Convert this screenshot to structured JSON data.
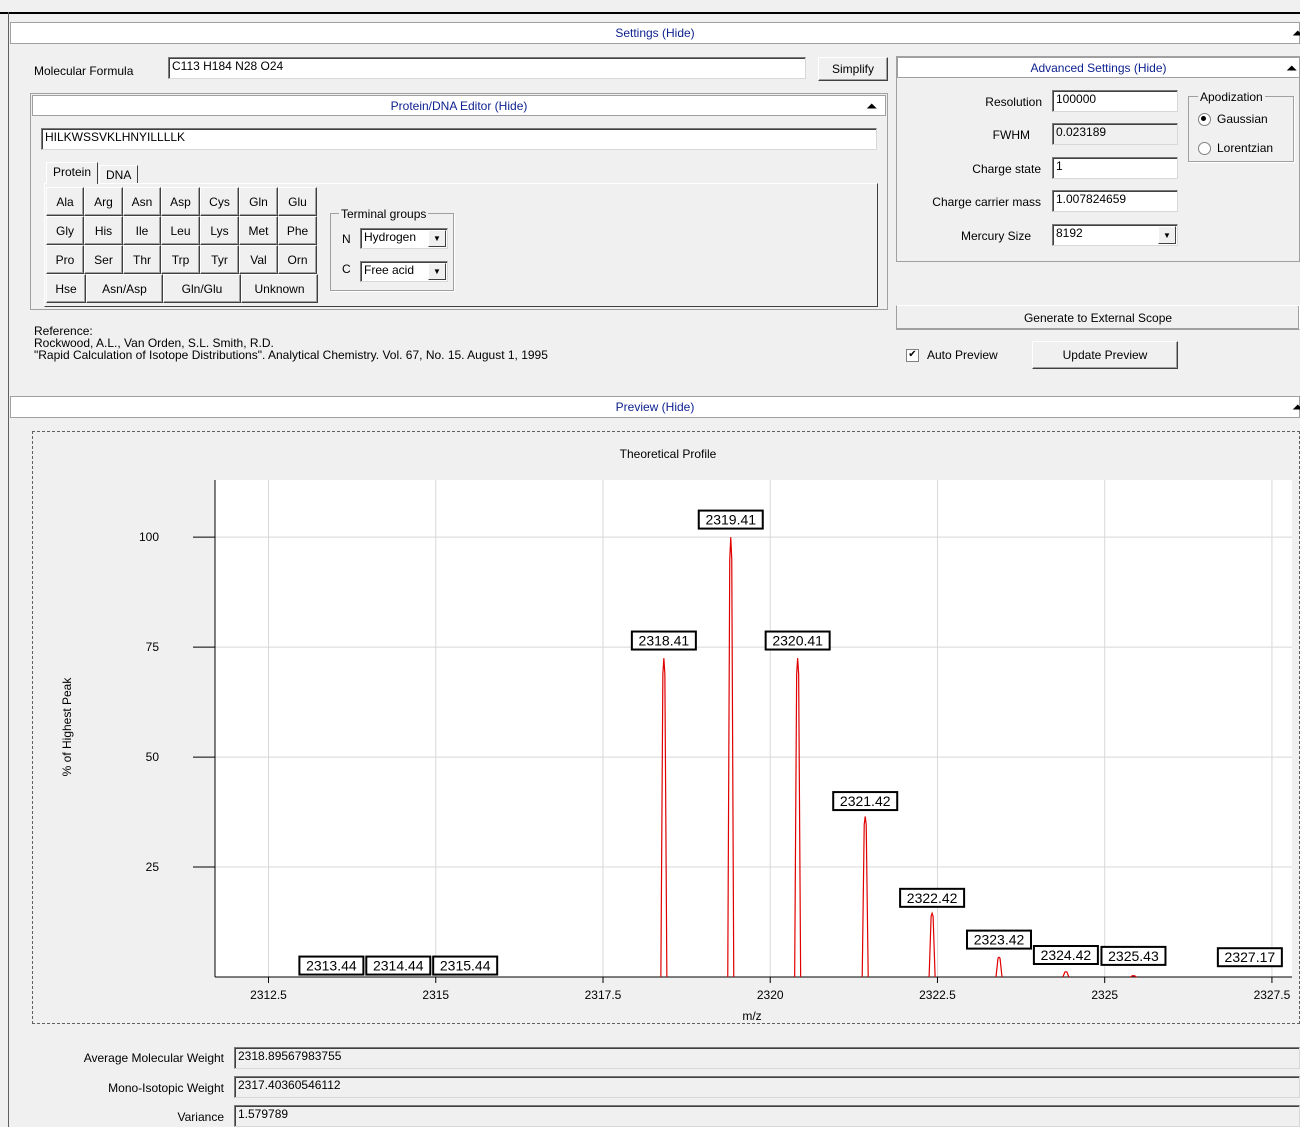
{
  "settings_bar": "Settings (Hide)",
  "molecular_formula": {
    "label": "Molecular Formula",
    "value": "C113 H184 N28 O24",
    "simplify": "Simplify"
  },
  "editor": {
    "bar": "Protein/DNA Editor (Hide)",
    "sequence": "HILKWSSVKLHNYILLLLK",
    "tabs": [
      "Protein",
      "DNA"
    ],
    "residues": [
      [
        "Ala",
        "Arg",
        "Asn",
        "Asp",
        "Cys",
        "Gln",
        "Glu"
      ],
      [
        "Gly",
        "His",
        "Ile",
        "Leu",
        "Lys",
        "Met",
        "Phe"
      ],
      [
        "Pro",
        "Ser",
        "Thr",
        "Trp",
        "Tyr",
        "Val",
        "Orn"
      ]
    ],
    "residues_last": [
      "Hse",
      "Asn/Asp",
      "Gln/Glu",
      "Unknown"
    ],
    "terminal": {
      "title": "Terminal groups",
      "n_label": "N",
      "n_value": "Hydrogen",
      "c_label": "C",
      "c_value": "Free acid"
    }
  },
  "reference": {
    "line1": "Reference:",
    "line2": "Rockwood, A.L., Van Orden, S.L. Smith, R.D.",
    "line3": "\"Rapid Calculation of Isotope Distributions\". Analytical Chemistry. Vol. 67, No. 15. August 1, 1995"
  },
  "advanced": {
    "bar": "Advanced Settings (Hide)",
    "resolution_label": "Resolution",
    "resolution": "100000",
    "fwhm_label": "FWHM",
    "fwhm": "0.023189",
    "charge_label": "Charge state",
    "charge": "1",
    "carrier_label": "Charge carrier mass",
    "carrier": "1.007824659",
    "mercury_label": "Mercury Size",
    "mercury": "8192",
    "apodization_title": "Apodization",
    "apod_options": [
      "Gaussian",
      "Lorentzian"
    ]
  },
  "generate_external": "Generate to External Scope",
  "auto_preview": "Auto Preview",
  "update_preview": "Update Preview",
  "preview_bar": "Preview  (Hide)",
  "chart_data": {
    "type": "line",
    "title": "Theoretical Profile",
    "xlabel": "m/z",
    "ylabel": "% of Highest Peak",
    "xlim": [
      2311.7,
      2327.8
    ],
    "ylim": [
      0,
      113
    ],
    "x_ticks": [
      "2312.5",
      "2315",
      "2317.5",
      "2320",
      "2322.5",
      "2325",
      "2327.5"
    ],
    "y_ticks": [
      "25",
      "50",
      "75",
      "100"
    ],
    "grid": true,
    "line_color": "#e00000",
    "peaks": [
      {
        "x": 2318.41,
        "y": 72.5
      },
      {
        "x": 2319.41,
        "y": 100
      },
      {
        "x": 2320.41,
        "y": 72.5
      },
      {
        "x": 2321.42,
        "y": 36.5
      },
      {
        "x": 2322.42,
        "y": 14.5
      },
      {
        "x": 2323.42,
        "y": 4.5
      },
      {
        "x": 2324.42,
        "y": 1.2
      },
      {
        "x": 2325.43,
        "y": 0.3
      }
    ],
    "labels": [
      "2313.44",
      "2314.44",
      "2315.44",
      "2318.41",
      "2319.41",
      "2320.41",
      "2321.42",
      "2322.42",
      "2323.42",
      "2324.42",
      "2325.43",
      "2327.17"
    ]
  },
  "results": {
    "avg_label": "Average Molecular Weight",
    "avg": "2318.89567983755",
    "mono_label": "Mono-Isotopic Weight",
    "mono": "2317.40360546112",
    "var_label": "Variance",
    "var": "1.579789"
  }
}
